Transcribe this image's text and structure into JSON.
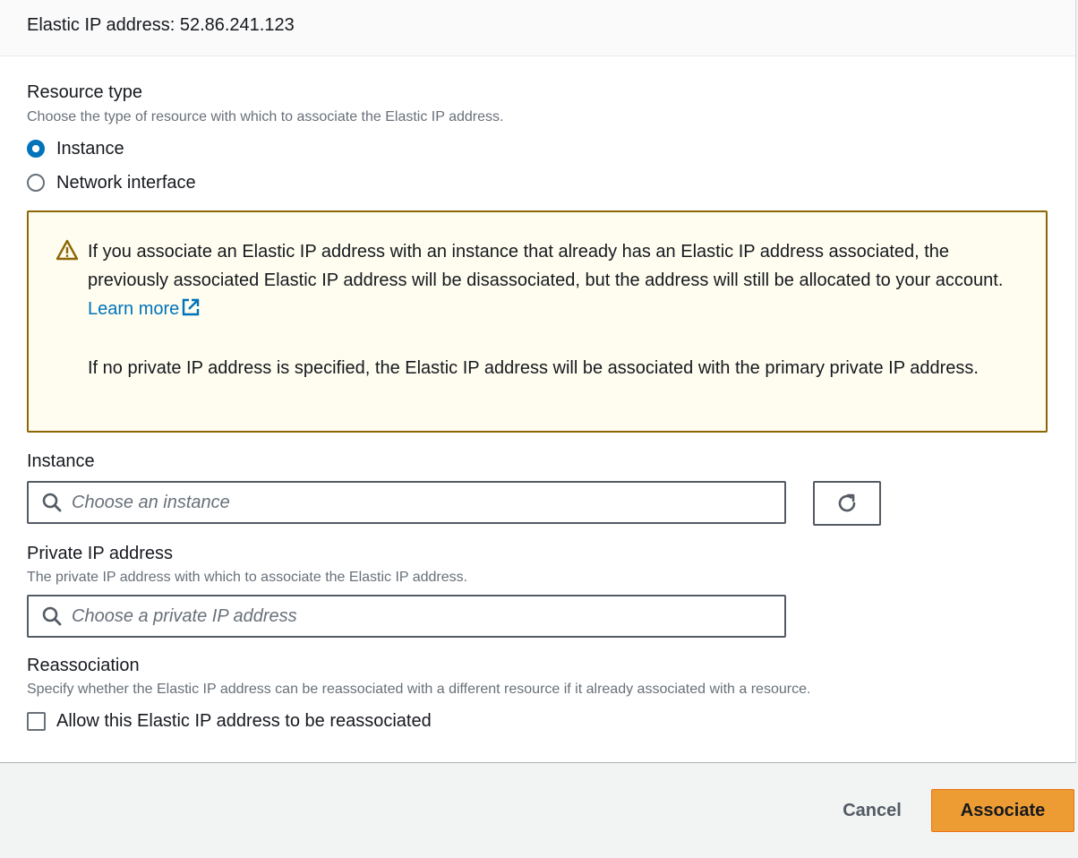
{
  "header": {
    "title": "Elastic IP address: 52.86.241.123"
  },
  "resource_type": {
    "label": "Resource type",
    "description": "Choose the type of resource with which to associate the Elastic IP address.",
    "options": [
      {
        "label": "Instance",
        "selected": true
      },
      {
        "label": "Network interface",
        "selected": false
      }
    ]
  },
  "alert": {
    "paragraph1": "If you associate an Elastic IP address with an instance that already has an Elastic IP address associated, the previously associated Elastic IP address will be disassociated, but the address will still be allocated to your account.",
    "learn_more": "Learn more",
    "paragraph2": "If no private IP address is specified, the Elastic IP address will be associated with the primary private IP address.",
    "border_color": "#8d6605",
    "background_color": "#fefdef"
  },
  "instance": {
    "label": "Instance",
    "placeholder": "Choose an instance",
    "value": ""
  },
  "private_ip": {
    "label": "Private IP address",
    "description": "The private IP address with which to associate the Elastic IP address.",
    "placeholder": "Choose a private IP address",
    "value": ""
  },
  "reassociation": {
    "label": "Reassociation",
    "description": "Specify whether the Elastic IP address can be reassociated with a different resource if it already associated with a resource.",
    "checkbox_label": "Allow this Elastic IP address to be reassociated",
    "checked": false
  },
  "footer": {
    "cancel_label": "Cancel",
    "associate_label": "Associate",
    "primary_color": "#ec9c32"
  },
  "icons": {
    "alert": "warning-icon",
    "external_link": "external-link-icon",
    "search": "search-icon",
    "refresh": "refresh-icon"
  }
}
